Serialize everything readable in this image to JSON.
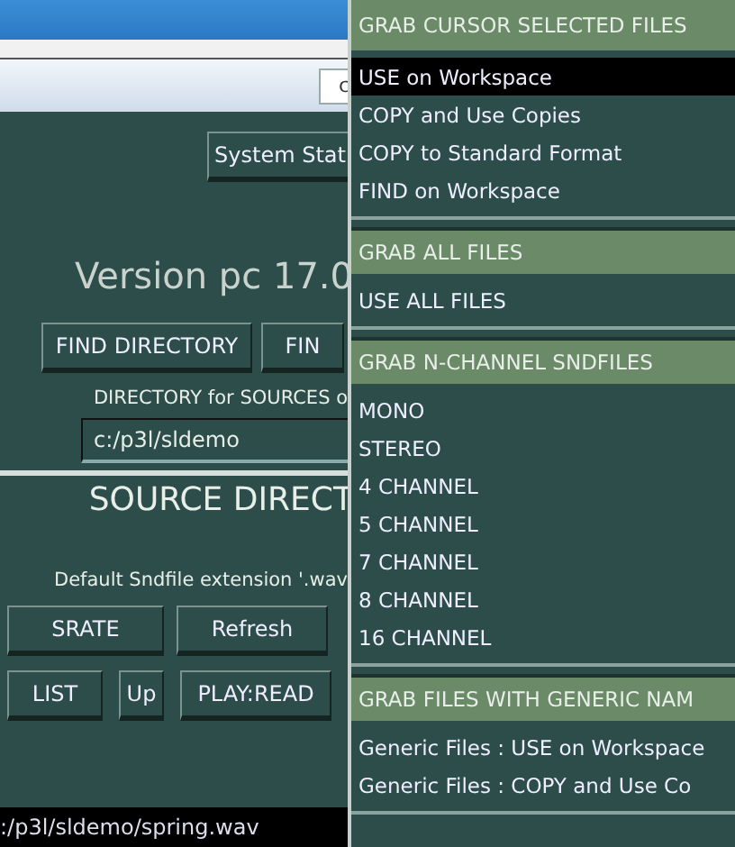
{
  "toolbar": {
    "field_value": "c"
  },
  "panel": {
    "system_button": "System Stat",
    "version": "Version pc 17.0",
    "find_buttons": [
      "FIND DIRECTORY",
      "FIN"
    ],
    "directory_label": "DIRECTORY for SOURCES o",
    "directory_value": "c:/p3l/sldemo",
    "source_title": "SOURCE DIRECT",
    "extension_label": "Default Sndfile extension '.wav",
    "buttons_row1": [
      "SRATE",
      "Refresh"
    ],
    "buttons_row2": [
      "LIST",
      "Up",
      "PLAY:READ"
    ],
    "path": ":/p3l/sldemo/spring.wav"
  },
  "menu": [
    {
      "header": "GRAB CURSOR SELECTED FILES",
      "items": [
        {
          "label": "USE on Workspace",
          "selected": true
        },
        {
          "label": "COPY and Use Copies",
          "selected": false
        },
        {
          "label": "COPY to Standard Format",
          "selected": false
        },
        {
          "label": "FIND on Workspace",
          "selected": false
        }
      ]
    },
    {
      "header": "GRAB ALL FILES",
      "items": [
        {
          "label": "USE ALL FILES",
          "selected": false
        }
      ]
    },
    {
      "header": "GRAB N-CHANNEL SNDFILES",
      "items": [
        {
          "label": "MONO",
          "selected": false
        },
        {
          "label": "STEREO",
          "selected": false
        },
        {
          "label": "4 CHANNEL",
          "selected": false
        },
        {
          "label": "5 CHANNEL",
          "selected": false
        },
        {
          "label": "7 CHANNEL",
          "selected": false
        },
        {
          "label": "8 CHANNEL",
          "selected": false
        },
        {
          "label": "16 CHANNEL",
          "selected": false
        }
      ]
    },
    {
      "header": "GRAB FILES WITH GENERIC NAM",
      "items": [
        {
          "label": "Generic Files : USE on Workspace",
          "selected": false
        },
        {
          "label": "Generic Files : COPY and Use Co",
          "selected": false
        }
      ]
    }
  ]
}
